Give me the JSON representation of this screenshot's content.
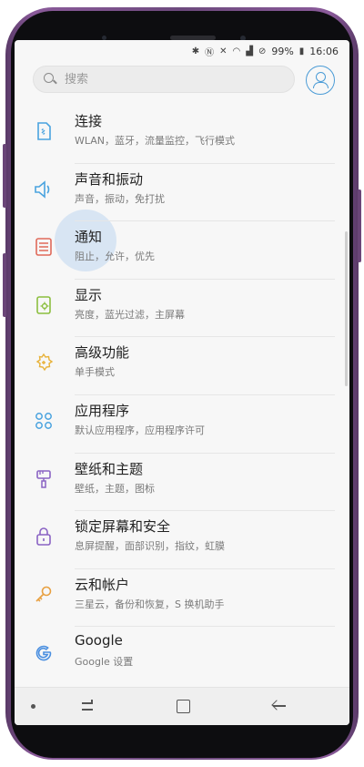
{
  "status_bar": {
    "icons": [
      "bluetooth-icon",
      "nfc-icon",
      "mute-icon",
      "wifi-icon",
      "signal-icon",
      "do-not-disturb-icon",
      "battery-icon"
    ],
    "battery": "99%",
    "time": "16:06"
  },
  "search": {
    "placeholder": "搜索"
  },
  "settings": [
    {
      "title": "连接",
      "subtitle": "WLAN，蓝牙，流量监控，飞行模式",
      "icon": "connections-icon",
      "color": "#4aa3df"
    },
    {
      "title": "声音和振动",
      "subtitle": "声音，振动，免打扰",
      "icon": "speaker-icon",
      "color": "#4aa3df"
    },
    {
      "title": "通知",
      "subtitle": "阻止，允许，优先",
      "icon": "notification-icon",
      "color": "#e06a5a"
    },
    {
      "title": "显示",
      "subtitle": "亮度，蓝光过滤，主屏幕",
      "icon": "display-icon",
      "color": "#8cbf3f"
    },
    {
      "title": "高级功能",
      "subtitle": "单手模式",
      "icon": "advanced-features-icon",
      "color": "#e8b23a"
    },
    {
      "title": "应用程序",
      "subtitle": "默认应用程序，应用程序许可",
      "icon": "apps-icon",
      "color": "#4aa3df"
    },
    {
      "title": "壁纸和主题",
      "subtitle": "壁纸，主题，图标",
      "icon": "brush-icon",
      "color": "#8a63c4"
    },
    {
      "title": "锁定屏幕和安全",
      "subtitle": "息屏提醒，面部识别，指纹，虹膜",
      "icon": "lock-icon",
      "color": "#8a63c4"
    },
    {
      "title": "云和帐户",
      "subtitle": "三星云，备份和恢复，S 换机助手",
      "icon": "key-icon",
      "color": "#e8a040"
    },
    {
      "title": "Google",
      "subtitle": "Google 设置",
      "icon": "google-icon",
      "color": "#4a8fe0"
    }
  ],
  "nav": {
    "items": [
      "nav-dot-icon",
      "recent-apps-icon",
      "home-icon",
      "back-icon"
    ]
  }
}
